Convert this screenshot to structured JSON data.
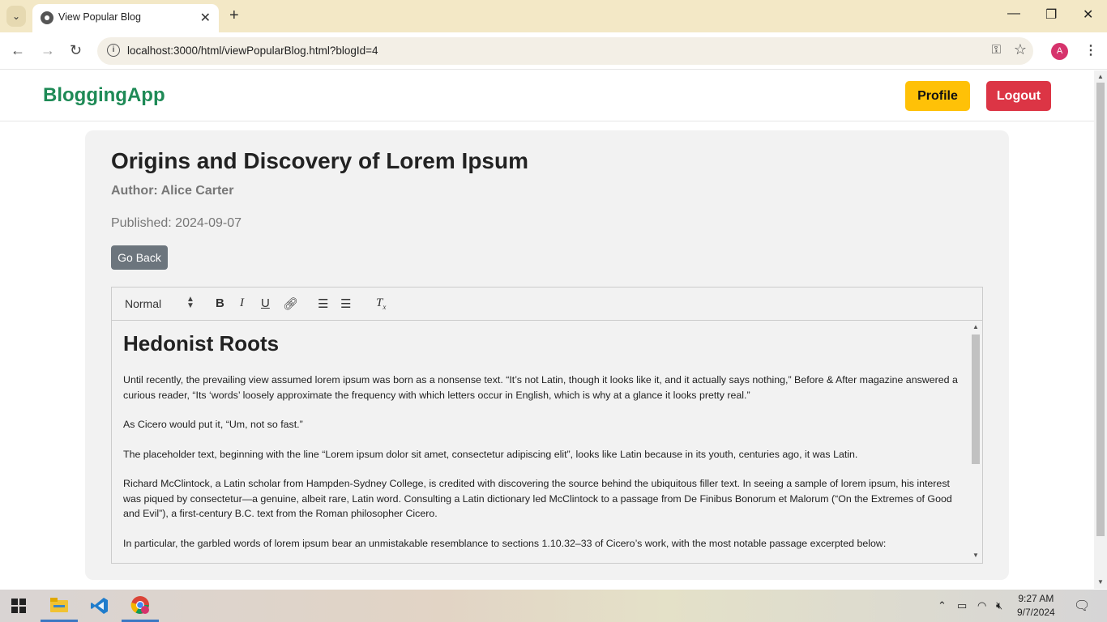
{
  "browser": {
    "tab_title": "View Popular Blog",
    "url": "localhost:3000/html/viewPopularBlog.html?blogId=4",
    "profile_initial": "A"
  },
  "navbar": {
    "brand": "BloggingApp",
    "profile_label": "Profile",
    "logout_label": "Logout"
  },
  "blog": {
    "title": "Origins and Discovery of Lorem Ipsum",
    "author": "Author: Alice Carter",
    "published": "Published: 2024-09-07",
    "back_label": "Go Back"
  },
  "editor": {
    "format_select": "Normal",
    "heading": "Hedonist Roots",
    "paragraphs": [
      "Until recently, the prevailing view assumed lorem ipsum was born as a nonsense text. “It’s not Latin, though it looks like it, and it actually says nothing,” Before & After magazine answered a curious reader, “Its ‘words’ loosely approximate the frequency with which letters occur in English, which is why at a glance it looks pretty real.”",
      "As Cicero would put it, “Um, not so fast.”",
      "The placeholder text, beginning with the line “Lorem ipsum dolor sit amet, consectetur adipiscing elit”, looks like Latin because in its youth, centuries ago, it was Latin.",
      "Richard McClintock, a Latin scholar from Hampden-Sydney College, is credited with discovering the source behind the ubiquitous filler text. In seeing a sample of lorem ipsum, his interest was piqued by consectetur—a genuine, albeit rare, Latin word. Consulting a Latin dictionary led McClintock to a passage from De Finibus Bonorum et Malorum (“On the Extremes of Good and Evil”), a first-century B.C. text from the Roman philosopher Cicero.",
      "In particular, the garbled words of lorem ipsum bear an unmistakable resemblance to sections 1.10.32–33 of Cicero’s work, with the most notable passage excerpted below:"
    ]
  },
  "taskbar": {
    "time": "9:27 AM",
    "date": "9/7/2024"
  },
  "colors": {
    "brand": "#1e8a56",
    "profile_button": "#ffc107",
    "logout_button": "#dc3545",
    "back_button": "#6c757d"
  }
}
